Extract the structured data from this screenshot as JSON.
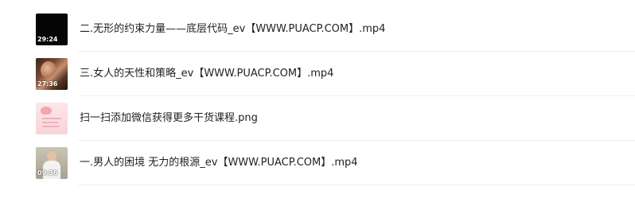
{
  "files": [
    {
      "name": "二.无形的约束力量——底层代码_ev【WWW.PUACP.COM】.mp4",
      "duration": "29:24",
      "thumbnail": "black-video-frame"
    },
    {
      "name": "三.女人的天性和策略_ev【WWW.PUACP.COM】.mp4",
      "duration": "27:36",
      "thumbnail": "dim-video-frame"
    },
    {
      "name": "扫一扫添加微信获得更多干货课程.png",
      "duration": "",
      "thumbnail": "pink-image-preview"
    },
    {
      "name": "一.男人的困境 无力的根源_ev【WWW.PUACP.COM】.mp4",
      "duration": "09:36",
      "thumbnail": "person-video-frame"
    }
  ],
  "colors": {
    "text": "#222222",
    "divider": "#efefef",
    "background": "#ffffff"
  }
}
